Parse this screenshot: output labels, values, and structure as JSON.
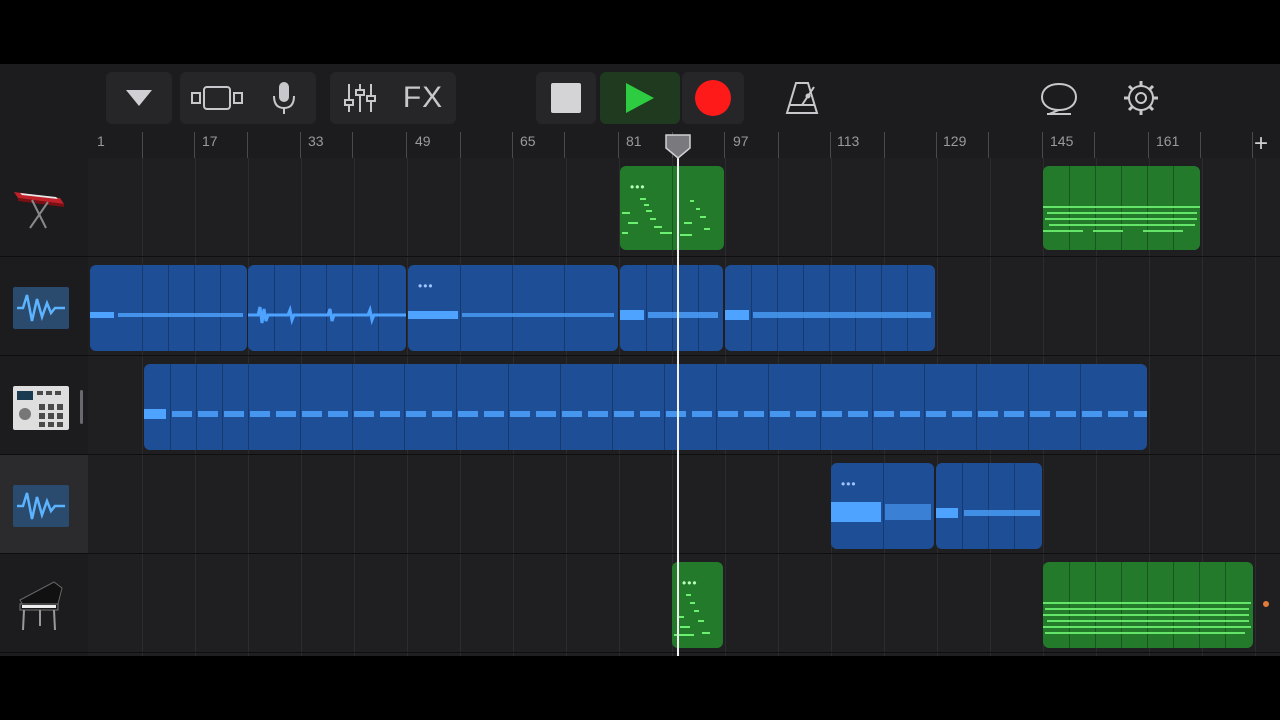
{
  "ruler": {
    "labels": [
      "1",
      "17",
      "33",
      "49",
      "65",
      "81",
      "97",
      "113",
      "129",
      "145",
      "161"
    ],
    "add_label": "+"
  },
  "toolbar": {
    "fx_label": "FX"
  },
  "transport": {
    "state": "playing",
    "playhead_bar": 88
  },
  "tracks": [
    {
      "name": "keyboard-track",
      "icon": "keyboard-icon",
      "type": "midi",
      "selected": false
    },
    {
      "name": "audio-track-1",
      "icon": "audio-waveform-icon",
      "type": "audio",
      "selected": false
    },
    {
      "name": "drum-machine-track",
      "icon": "drum-machine-icon",
      "type": "audio",
      "selected": false
    },
    {
      "name": "audio-track-2",
      "icon": "audio-waveform-icon",
      "type": "audio",
      "selected": true
    },
    {
      "name": "piano-track",
      "icon": "grand-piano-icon",
      "type": "midi",
      "selected": false
    }
  ],
  "colors": {
    "background": "#1c1c1e",
    "audio_region": "#1e4f96",
    "midi_region": "#237a2a",
    "play_green": "#2ecc40",
    "record_red": "#ff1a1a",
    "waveform": "#4da3ff"
  }
}
